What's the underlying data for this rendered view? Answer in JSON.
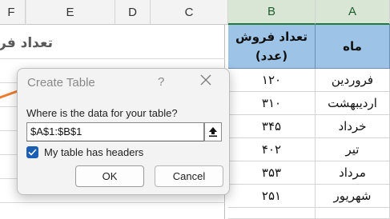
{
  "columns": [
    "F",
    "E",
    "D",
    "C",
    "B",
    "A"
  ],
  "table": {
    "header_b": "تعداد فروش (عدد)",
    "header_a": "ماه",
    "rows": [
      {
        "month": "فروردین",
        "sales": "۱۲۰"
      },
      {
        "month": "اردیبهشت",
        "sales": "۳۱۰"
      },
      {
        "month": "خرداد",
        "sales": "۳۴۵"
      },
      {
        "month": "تیر",
        "sales": "۴۰۲"
      },
      {
        "month": "مرداد",
        "sales": "۳۵۳"
      },
      {
        "month": "شهریور",
        "sales": "۲۵۱"
      }
    ]
  },
  "chart": {
    "title": "تعداد فر",
    "line_color": "#ed7d31"
  },
  "dialog": {
    "title": "Create Table",
    "help": "?",
    "prompt": "Where is the data for your table?",
    "range_value": "$A$1:$B$1",
    "headers_checked": true,
    "headers_label": "My table has headers",
    "ok_label": "OK",
    "cancel_label": "Cancel"
  },
  "colors": {
    "header_fill": "#9dc3e6",
    "checkbox": "#1a5fb4"
  }
}
